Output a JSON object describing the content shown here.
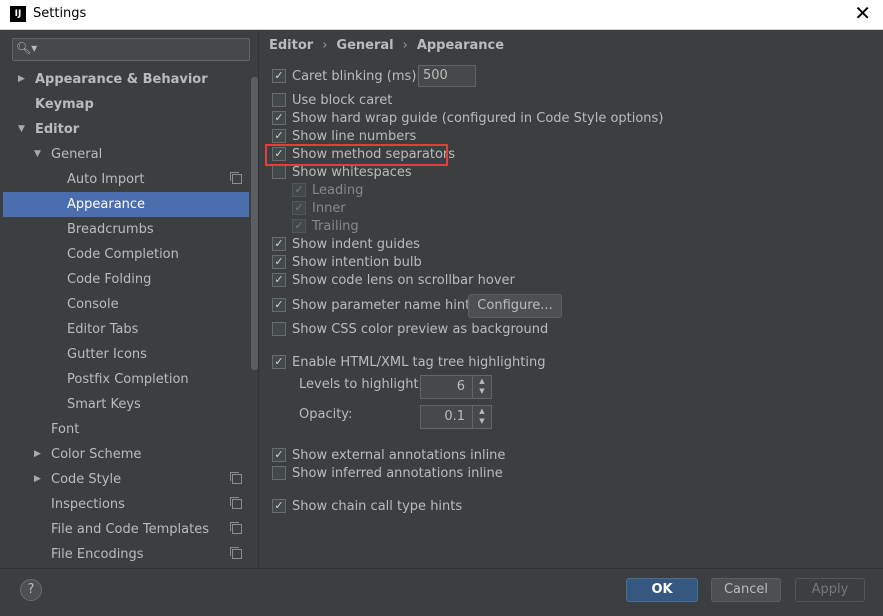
{
  "window": {
    "title": "Settings",
    "app_icon": "IJ"
  },
  "search": {
    "placeholder": ""
  },
  "sidebar": {
    "items": [
      {
        "label": "Appearance & Behavior"
      },
      {
        "label": "Keymap"
      },
      {
        "label": "Editor"
      },
      {
        "label": "General"
      },
      {
        "label": "Auto Import"
      },
      {
        "label": "Appearance"
      },
      {
        "label": "Breadcrumbs"
      },
      {
        "label": "Code Completion"
      },
      {
        "label": "Code Folding"
      },
      {
        "label": "Console"
      },
      {
        "label": "Editor Tabs"
      },
      {
        "label": "Gutter Icons"
      },
      {
        "label": "Postfix Completion"
      },
      {
        "label": "Smart Keys"
      },
      {
        "label": "Font"
      },
      {
        "label": "Color Scheme"
      },
      {
        "label": "Code Style"
      },
      {
        "label": "Inspections"
      },
      {
        "label": "File and Code Templates"
      },
      {
        "label": "File Encodings"
      }
    ]
  },
  "breadcrumb": {
    "parts": [
      "Editor",
      "General",
      "Appearance"
    ]
  },
  "options": {
    "caret_blinking": "Caret blinking (ms):",
    "caret_blinking_value": "500",
    "block_caret": "Use block caret",
    "hard_wrap": "Show hard wrap guide (configured in Code Style options)",
    "line_numbers": "Show line numbers",
    "method_separators": "Show method separators",
    "whitespaces": "Show whitespaces",
    "leading": "Leading",
    "inner": "Inner",
    "trailing": "Trailing",
    "indent_guides": "Show indent guides",
    "intention_bulb": "Show intention bulb",
    "code_lens": "Show code lens on scrollbar hover",
    "param_hints": "Show parameter name hints",
    "configure": "Configure...",
    "css_preview": "Show CSS color preview as background",
    "tag_tree": "Enable HTML/XML tag tree highlighting",
    "levels_label": "Levels to highlight:",
    "levels_value": "6",
    "opacity_label": "Opacity:",
    "opacity_value": "0.1",
    "external_annotations": "Show external annotations inline",
    "inferred_annotations": "Show inferred annotations inline",
    "chain_call": "Show chain call type hints"
  },
  "footer": {
    "help": "?",
    "ok": "OK",
    "cancel": "Cancel",
    "apply": "Apply"
  }
}
